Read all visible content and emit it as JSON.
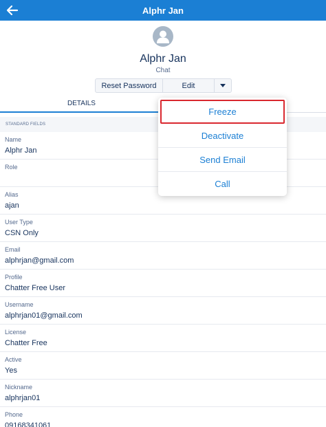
{
  "header": {
    "title": "Alphr Jan",
    "back_icon": "arrow-left-icon"
  },
  "profile": {
    "name": "Alphr Jan",
    "subtitle": "Chat",
    "avatar_icon": "user-avatar-icon"
  },
  "actions": {
    "reset_password": "Reset Password",
    "edit": "Edit",
    "more_icon": "caret-down-icon"
  },
  "tabs": [
    {
      "label": "DETAILS",
      "active": true
    }
  ],
  "section": {
    "title": "STANDARD FIELDS"
  },
  "fields": [
    {
      "label": "Name",
      "value": "Alphr Jan"
    },
    {
      "label": "Role",
      "value": ""
    },
    {
      "label": "Alias",
      "value": "ajan"
    },
    {
      "label": "User Type",
      "value": "CSN Only"
    },
    {
      "label": "Email",
      "value": "alphrjan@gmail.com"
    },
    {
      "label": "Profile",
      "value": "Chatter Free User"
    },
    {
      "label": "Username",
      "value": "alphrjan01@gmail.com"
    },
    {
      "label": "License",
      "value": "Chatter Free"
    },
    {
      "label": "Active",
      "value": "Yes"
    },
    {
      "label": "Nickname",
      "value": "alphrjan01"
    },
    {
      "label": "Phone",
      "value": "09168341061"
    }
  ],
  "menu": {
    "items": [
      {
        "label": "Freeze",
        "highlighted": true
      },
      {
        "label": "Deactivate"
      },
      {
        "label": "Send Email"
      },
      {
        "label": "Call"
      }
    ]
  },
  "colors": {
    "header": "#1b7fd4",
    "link": "#1b7fd4",
    "highlight_border": "#d9272e",
    "text": "#16325c",
    "muted": "#54698d"
  }
}
